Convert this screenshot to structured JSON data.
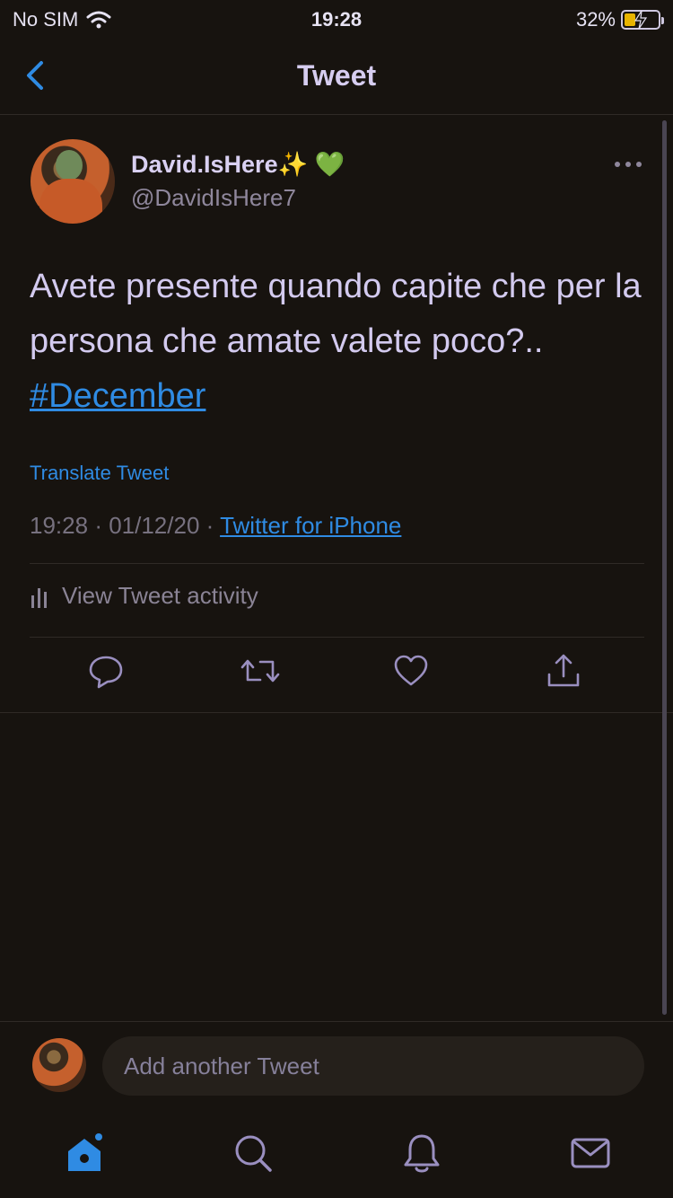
{
  "status_bar": {
    "carrier": "No SIM",
    "time": "19:28",
    "battery_percent": "32%",
    "battery_level": 0.32
  },
  "nav": {
    "title": "Tweet",
    "back_icon": "chevron-left-icon"
  },
  "tweet": {
    "display_name": "David.IsHere",
    "name_emojis": "✨ 💚",
    "handle": "@DavidIsHere7",
    "text": "Avete presente quando capite che per la persona che amate valete poco?..",
    "hashtag": "#December",
    "translate_label": "Translate Tweet",
    "time": "19:28",
    "date": "01/12/20",
    "source": "Twitter for iPhone",
    "activity_label": "View Tweet activity"
  },
  "actions": [
    {
      "name": "reply",
      "icon": "reply-icon"
    },
    {
      "name": "retweet",
      "icon": "retweet-icon"
    },
    {
      "name": "like",
      "icon": "heart-icon"
    },
    {
      "name": "share",
      "icon": "share-icon"
    }
  ],
  "reply_bar": {
    "placeholder": "Add another Tweet"
  },
  "tab_bar": [
    {
      "name": "home",
      "icon": "home-icon",
      "active": true
    },
    {
      "name": "search",
      "icon": "search-icon",
      "active": false
    },
    {
      "name": "notifications",
      "icon": "bell-icon",
      "active": false
    },
    {
      "name": "messages",
      "icon": "mail-icon",
      "active": false
    }
  ],
  "colors": {
    "accent": "#2f8be3",
    "background": "#17130f",
    "text": "#d3caef",
    "secondary_text": "#8f879c"
  }
}
